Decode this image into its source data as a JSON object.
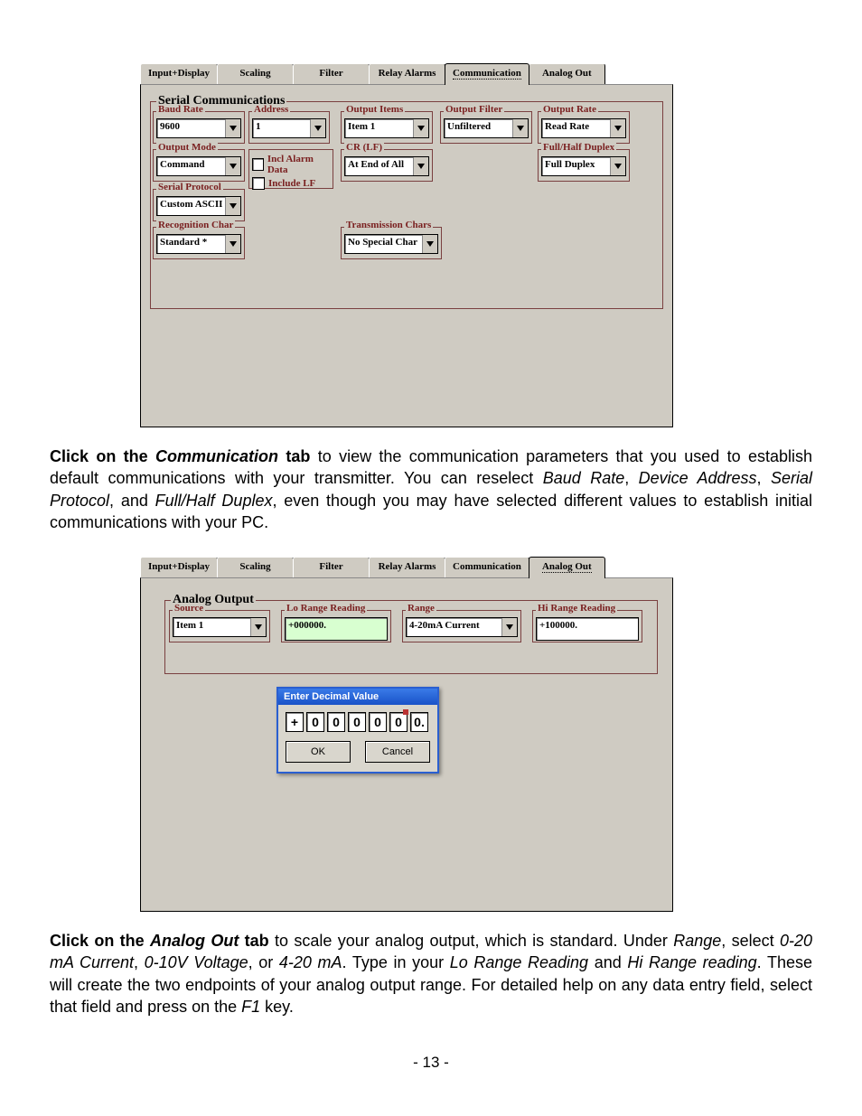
{
  "tabs": {
    "input_display": "Input+Display",
    "scaling": "Scaling",
    "filter": "Filter",
    "relay_alarms": "Relay Alarms",
    "communication": "Communication",
    "analog_out": "Analog Out"
  },
  "serial_comm": {
    "title": "Serial Communications",
    "baud_rate": {
      "label": "Baud Rate",
      "value": "9600"
    },
    "address": {
      "label": "Address",
      "value": "1"
    },
    "output_items": {
      "label": "Output Items",
      "value": "Item 1"
    },
    "output_filter": {
      "label": "Output Filter",
      "value": "Unfiltered"
    },
    "output_rate": {
      "label": "Output Rate",
      "value": "Read Rate"
    },
    "output_mode": {
      "label": "Output Mode",
      "value": "Command"
    },
    "incl_alarm_data": "Incl Alarm Data",
    "include_lf": "Include LF",
    "crlf": {
      "label": "CR (LF)",
      "value": "At End of All"
    },
    "full_half_duplex": {
      "label": "Full/Half Duplex",
      "value": "Full Duplex"
    },
    "serial_protocol": {
      "label": "Serial Protocol",
      "value": "Custom ASCII"
    },
    "recognition_char": {
      "label": "Recognition Char",
      "value": "Standard *"
    },
    "transmission_chars": {
      "label": "Transmission Chars",
      "value": "No Special Char"
    }
  },
  "para1": {
    "lead_bold": "Click on the ",
    "lead_boldital": "Communication",
    "lead_bold2": " tab",
    "body1": " to view the communication parameters that you used to establish default communications with your transmitter. You can reselect ",
    "i1": "Baud Rate",
    "c1": ", ",
    "i2": "Device Address",
    "c2": ", ",
    "i3": "Serial Protocol",
    "c3": ", and ",
    "i4": "Full/Half Duplex",
    "body2": ", even though you may have selected different values to establish initial communications with your PC."
  },
  "analog_output": {
    "title": "Analog Output",
    "source": {
      "label": "Source",
      "value": "Item 1"
    },
    "lo_range_reading": {
      "label": "Lo Range Reading",
      "value": "+000000."
    },
    "range": {
      "label": "Range",
      "value": "4-20mA Current"
    },
    "hi_range_reading": {
      "label": "Hi Range Reading",
      "value": "+100000."
    }
  },
  "dialog": {
    "title": "Enter Decimal Value",
    "digits": [
      "+",
      "0",
      "0",
      "0",
      "0",
      "0",
      "0."
    ],
    "ok": "OK",
    "cancel": "Cancel"
  },
  "para2": {
    "lead_bold": "Click on the ",
    "lead_boldital": "Analog Out",
    "lead_bold2": " tab",
    "body1": " to scale your analog output, which is standard. Under ",
    "i1": "Range",
    "c1": ", select ",
    "i2": "0-20 mA Current",
    "c2": ", ",
    "i3": "0-10V Voltage",
    "c3": ", or ",
    "i4": "4-20 mA",
    "c4": ". Type in your ",
    "i5": "Lo Range Reading",
    "c5": " and ",
    "i6": "Hi Range reading",
    "body2": ". These will create the two endpoints of your analog output range. For detailed help on any data entry field, select that field and press on the ",
    "i7": "F1",
    "body3": " key."
  },
  "page_number": "- 13 -"
}
